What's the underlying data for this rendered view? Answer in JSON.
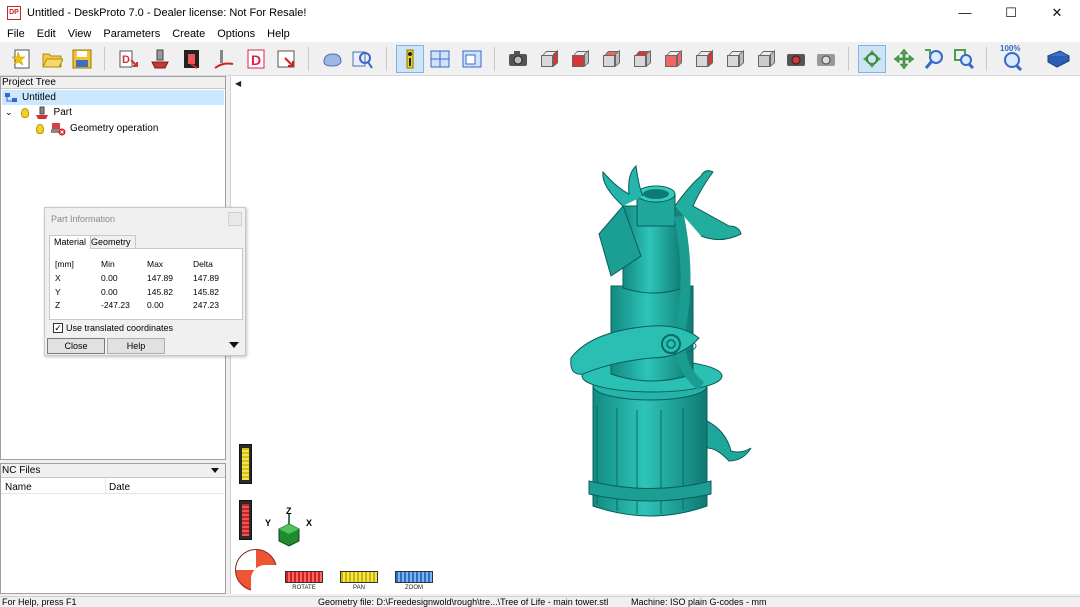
{
  "window": {
    "title": "Untitled - DeskProto 7.0 - Dealer license: Not For Resale!",
    "icon": "deskproto-icon",
    "icon_text": "DP",
    "controls": {
      "minimize": "—",
      "maximize": "☐",
      "close": "✕"
    }
  },
  "menu": [
    "File",
    "Edit",
    "View",
    "Parameters",
    "Create",
    "Options",
    "Help"
  ],
  "toolbar": {
    "active_tool": "part-information-button",
    "zoom_level_label": "100%"
  },
  "project_tree": {
    "header": "Project Tree",
    "items": [
      {
        "label": "Untitled",
        "level": 0,
        "selected": true,
        "icon": "project-icon"
      },
      {
        "label": "Part",
        "level": 1,
        "selected": false,
        "icon": "part-icon",
        "expanded": true
      },
      {
        "label": "Geometry operation",
        "level": 2,
        "selected": false,
        "icon": "geometry-operation-icon"
      }
    ]
  },
  "nc_files": {
    "header": "NC Files",
    "columns": [
      "Name",
      "Date"
    ]
  },
  "part_info_dialog": {
    "title": "Part Information",
    "tabs": [
      "Material",
      "Geometry"
    ],
    "active_tab": "Material",
    "table": {
      "headers": [
        "[mm]",
        "Min",
        "Max",
        "Delta"
      ],
      "rows": [
        {
          "axis": "X",
          "min": "0.00",
          "max": "147.89",
          "delta": "147.89"
        },
        {
          "axis": "Y",
          "min": "0.00",
          "max": "145.82",
          "delta": "145.82"
        },
        {
          "axis": "Z",
          "min": "-247.23",
          "max": "0.00",
          "delta": "247.23"
        }
      ]
    },
    "checkbox_label": "Use translated coordinates",
    "checkbox_checked": true,
    "close_label": "Close",
    "help_label": "Help"
  },
  "viewport": {
    "background": "#ffffff",
    "model_color": "#1fa8a0",
    "axis_labels": {
      "z": "Z",
      "y": "Y",
      "x": "X"
    },
    "controls": {
      "rotate": "ROTATE",
      "pan": "PAN",
      "zoom": "ZOOM"
    }
  },
  "status": {
    "help": "For Help, press F1",
    "geometry": "Geometry file: D:\\Freedesignwold\\rough\\tre...\\Tree of Life - main tower.stl",
    "machine": "Machine: ISO plain G-codes - mm"
  }
}
